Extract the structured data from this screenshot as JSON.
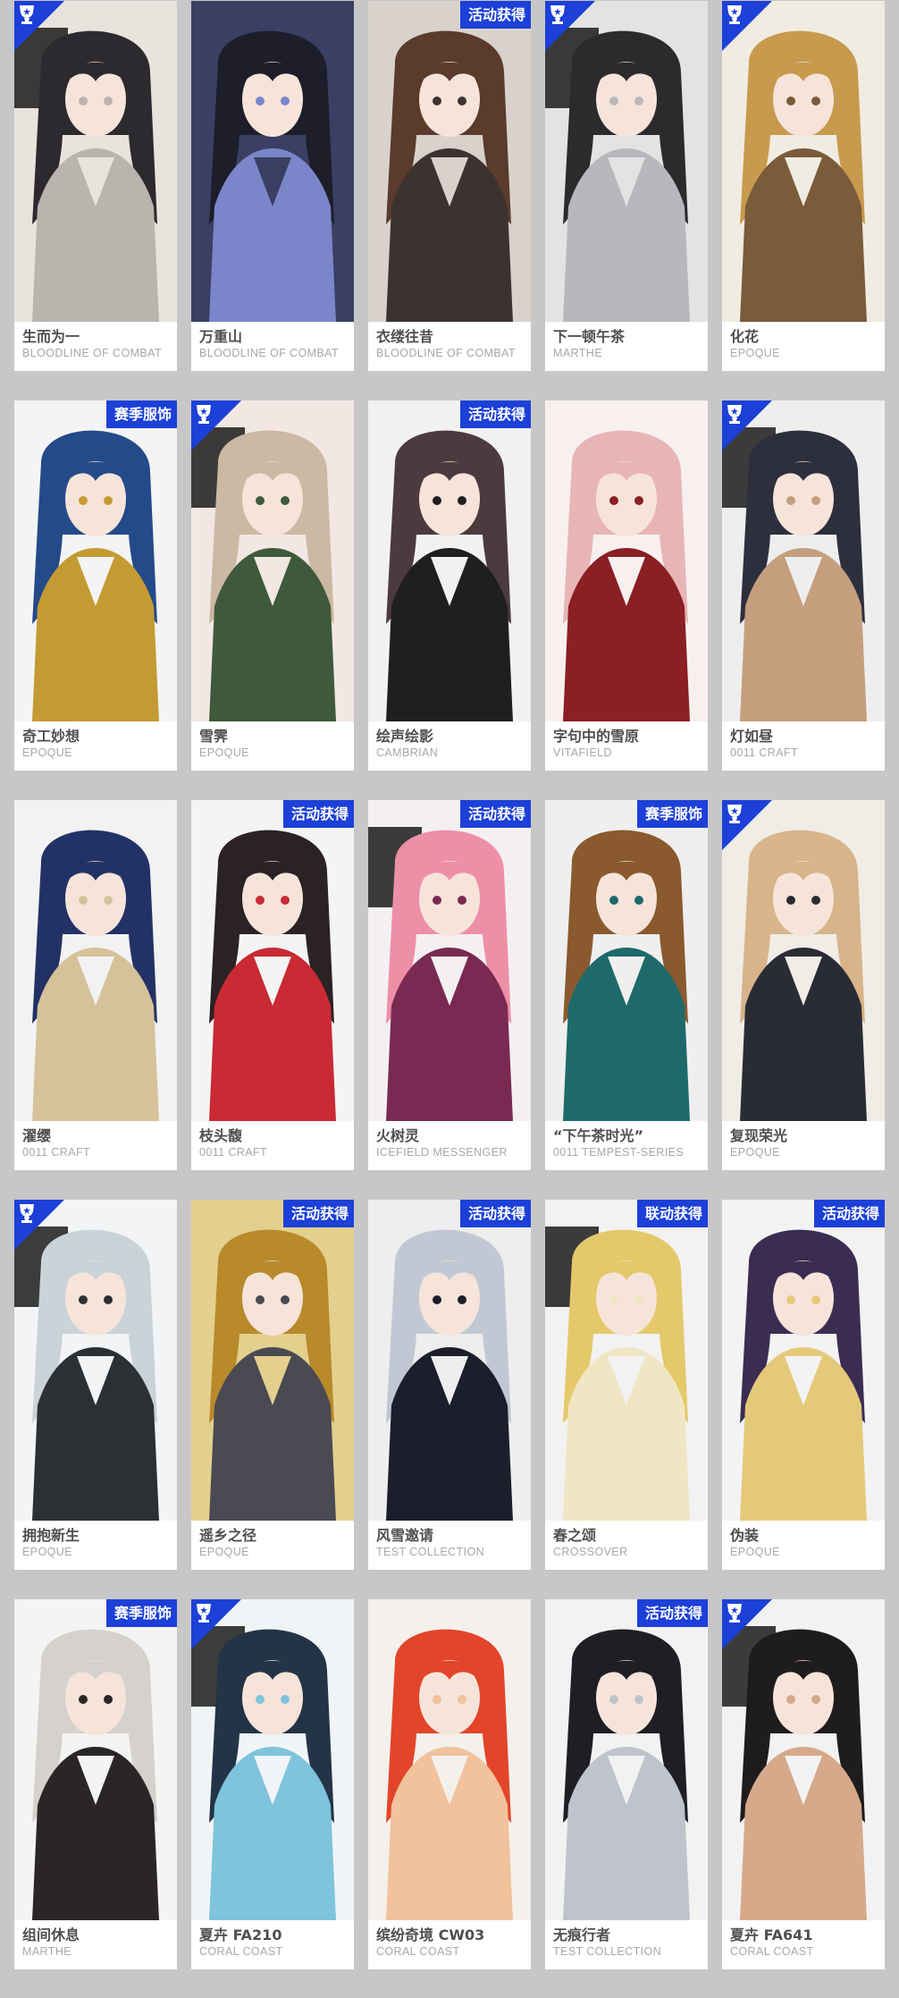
{
  "colors": {
    "page_background": "#c7c7c7",
    "card_background": "#ffffff",
    "tag_background": "#1c40d8",
    "name_text": "#4f4f4f",
    "series_text": "#a7a7a7"
  },
  "corner_badge_icon": "trophy-badge-icon",
  "cards": [
    {
      "name": "生而为一",
      "series": "BLOODLINE OF COMBAT",
      "tag": "",
      "corner_badge": true,
      "palette": [
        "#e8e3dc",
        "#2c2a2e",
        "#b9b4ae"
      ]
    },
    {
      "name": "万重山",
      "series": "BLOODLINE OF COMBAT",
      "tag": "",
      "corner_badge": false,
      "palette": [
        "#3a3f63",
        "#1d1e2a",
        "#7a86c9"
      ]
    },
    {
      "name": "衣缕往昔",
      "series": "BLOODLINE OF COMBAT",
      "tag": "活动获得",
      "corner_badge": false,
      "palette": [
        "#d9d2cc",
        "#5a3b2c",
        "#3c3331"
      ]
    },
    {
      "name": "下一顿午茶",
      "series": "MARTHE",
      "tag": "",
      "corner_badge": true,
      "palette": [
        "#e3e3e3",
        "#2b2b2e",
        "#b8b8bc"
      ]
    },
    {
      "name": "化花",
      "series": "EPOQUE",
      "tag": "",
      "corner_badge": true,
      "palette": [
        "#f1ece2",
        "#c79a4e",
        "#7a5b3a"
      ]
    },
    {
      "name": "奇工妙想",
      "series": "EPOQUE",
      "tag": "赛季服饰",
      "corner_badge": false,
      "palette": [
        "#f4f4f4",
        "#244a8a",
        "#c49a32"
      ]
    },
    {
      "name": "雪霁",
      "series": "EPOQUE",
      "tag": "",
      "corner_badge": true,
      "palette": [
        "#f2e7e3",
        "#cbb9a3",
        "#3f5a3b"
      ]
    },
    {
      "name": "绘声绘影",
      "series": "CAMBRIAN",
      "tag": "活动获得",
      "corner_badge": false,
      "palette": [
        "#f1f1f1",
        "#4c3a3f",
        "#1f1f22"
      ]
    },
    {
      "name": "字句中的雪原",
      "series": "VITAFIELD",
      "tag": "",
      "corner_badge": false,
      "palette": [
        "#f7f0ef",
        "#e8b5b6",
        "#8a1f24"
      ]
    },
    {
      "name": "灯如昼",
      "series": "0011 CRAFT",
      "tag": "",
      "corner_badge": true,
      "palette": [
        "#eeeeee",
        "#2d2f3d",
        "#c59f7d"
      ]
    },
    {
      "name": "濯缨",
      "series": "0011 CRAFT",
      "tag": "",
      "corner_badge": false,
      "palette": [
        "#f2f2f2",
        "#233266",
        "#d6c29a"
      ]
    },
    {
      "name": "枝头馥",
      "series": "0011 CRAFT",
      "tag": "活动获得",
      "corner_badge": false,
      "palette": [
        "#f4f4f4",
        "#2b2224",
        "#c92a33"
      ]
    },
    {
      "name": "火树灵",
      "series": "ICEFIELD MESSENGER",
      "tag": "活动获得",
      "corner_badge": false,
      "palette": [
        "#f4f0f2",
        "#ee8fa8",
        "#7a2a52"
      ]
    },
    {
      "name": "“下午茶时光”",
      "series": "0011 TEMPEST-SERIES",
      "tag": "赛季服饰",
      "corner_badge": false,
      "palette": [
        "#efefef",
        "#8a5a2e",
        "#1e6a6a"
      ]
    },
    {
      "name": "复现荣光",
      "series": "EPOQUE",
      "tag": "",
      "corner_badge": true,
      "palette": [
        "#f0ece6",
        "#d8b48a",
        "#2a2c35"
      ]
    },
    {
      "name": "拥抱新生",
      "series": "EPOQUE",
      "tag": "",
      "corner_badge": true,
      "palette": [
        "#f2f4f5",
        "#c9d3d8",
        "#2c2f33"
      ]
    },
    {
      "name": "遥乡之径",
      "series": "EPOQUE",
      "tag": "活动获得",
      "corner_badge": false,
      "palette": [
        "#e3d08e",
        "#b98a2a",
        "#4a4a52"
      ]
    },
    {
      "name": "风雪邀请",
      "series": "TEST COLLECTION",
      "tag": "活动获得",
      "corner_badge": false,
      "palette": [
        "#eeeeee",
        "#c2c8d3",
        "#1c1e2b"
      ]
    },
    {
      "name": "春之颂",
      "series": "CROSSOVER",
      "tag": "联动获得",
      "corner_badge": false,
      "palette": [
        "#f2f2f2",
        "#e5c86a",
        "#f0e6c4"
      ]
    },
    {
      "name": "伪装",
      "series": "EPOQUE",
      "tag": "活动获得",
      "corner_badge": false,
      "palette": [
        "#f3f3f3",
        "#3b2d52",
        "#e5c97a"
      ]
    },
    {
      "name": "组间休息",
      "series": "MARTHE",
      "tag": "赛季服饰",
      "corner_badge": false,
      "palette": [
        "#f4f4f4",
        "#d5d2cd",
        "#2a2526"
      ]
    },
    {
      "name": "夏卉 FA210",
      "series": "CORAL COAST",
      "tag": "",
      "corner_badge": true,
      "palette": [
        "#f1f4f6",
        "#233447",
        "#7ec4dc"
      ]
    },
    {
      "name": "缤纷奇境 CW03",
      "series": "CORAL COAST",
      "tag": "",
      "corner_badge": false,
      "palette": [
        "#f4f0ec",
        "#e2452a",
        "#f1c29b"
      ]
    },
    {
      "name": "无痕行者",
      "series": "TEST COLLECTION",
      "tag": "活动获得",
      "corner_badge": false,
      "palette": [
        "#f2f2f2",
        "#1e1e24",
        "#bfc3cc"
      ]
    },
    {
      "name": "夏卉 FA641",
      "series": "CORAL COAST",
      "tag": "",
      "corner_badge": true,
      "palette": [
        "#f2f2f2",
        "#1f1c1d",
        "#d6a98a"
      ]
    }
  ]
}
